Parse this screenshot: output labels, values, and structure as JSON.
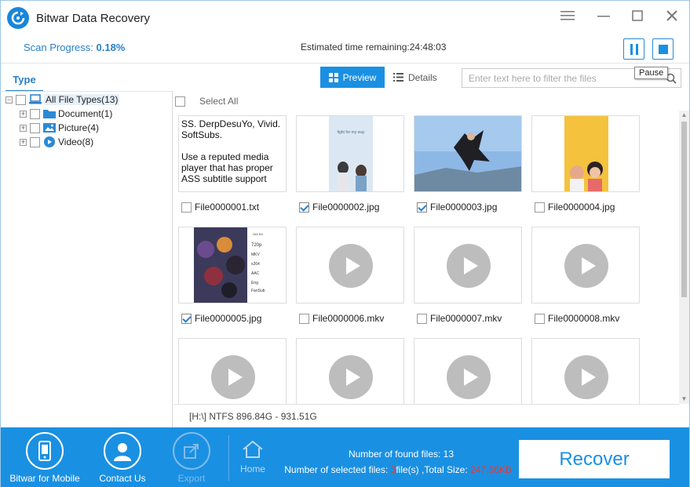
{
  "window": {
    "title": "Bitwar Data Recovery"
  },
  "progress": {
    "scan_label": "Scan Progress: ",
    "scan_value": "0.18%",
    "eta": "Estimated time remaining:24:48:03",
    "tooltip": "Pause"
  },
  "toolbar": {
    "type_tab": "Type",
    "preview_label": "Preview",
    "details_label": "Details",
    "filter_placeholder": "Enter text here to filter the files"
  },
  "tree": {
    "root": "All File Types(13)",
    "items": [
      {
        "label": "Document(1)",
        "icon": "folder-icon"
      },
      {
        "label": "Picture(4)",
        "icon": "picture-icon"
      },
      {
        "label": "Video(8)",
        "icon": "video-icon"
      }
    ]
  },
  "content": {
    "select_all": "Select All",
    "files": [
      {
        "name": "File0000001.txt",
        "checked": false,
        "kind": "txt",
        "preview": "SS. DerpDesuYo, Vivid. SoftSubs.\n\nUse a reputed media player that has proper ASS subtitle support"
      },
      {
        "name": "File0000002.jpg",
        "checked": true,
        "kind": "jpg",
        "poster_text": "fight for my way"
      },
      {
        "name": "File0000003.jpg",
        "checked": true,
        "kind": "jpg"
      },
      {
        "name": "File0000004.jpg",
        "checked": false,
        "kind": "jpg"
      },
      {
        "name": "File0000005.jpg",
        "checked": true,
        "kind": "jpg",
        "poster_text": "720p"
      },
      {
        "name": "File0000006.mkv",
        "checked": false,
        "kind": "mkv"
      },
      {
        "name": "File0000007.mkv",
        "checked": false,
        "kind": "mkv"
      },
      {
        "name": "File0000008.mkv",
        "checked": false,
        "kind": "mkv"
      },
      {
        "name": "",
        "checked": false,
        "kind": "mkv"
      },
      {
        "name": "",
        "checked": false,
        "kind": "mkv"
      },
      {
        "name": "",
        "checked": false,
        "kind": "mkv"
      },
      {
        "name": "",
        "checked": false,
        "kind": "mkv"
      }
    ],
    "drive_info": "[H:\\] NTFS 896.84G - 931.51G"
  },
  "bottom": {
    "mobile_label": "Bitwar for Mobile",
    "contact_label": "Contact Us",
    "export_label": "Export",
    "home_label": "Home",
    "found_text": "Number of found files: 13",
    "selected_prefix": "Number of selected files: ",
    "selected_count": "3",
    "selected_mid": "file(s) ,Total Size: ",
    "total_size": "247.66KB",
    "recover_label": "Recover"
  },
  "colors": {
    "accent": "#1a90e2",
    "highlight_red": "#e53935"
  }
}
